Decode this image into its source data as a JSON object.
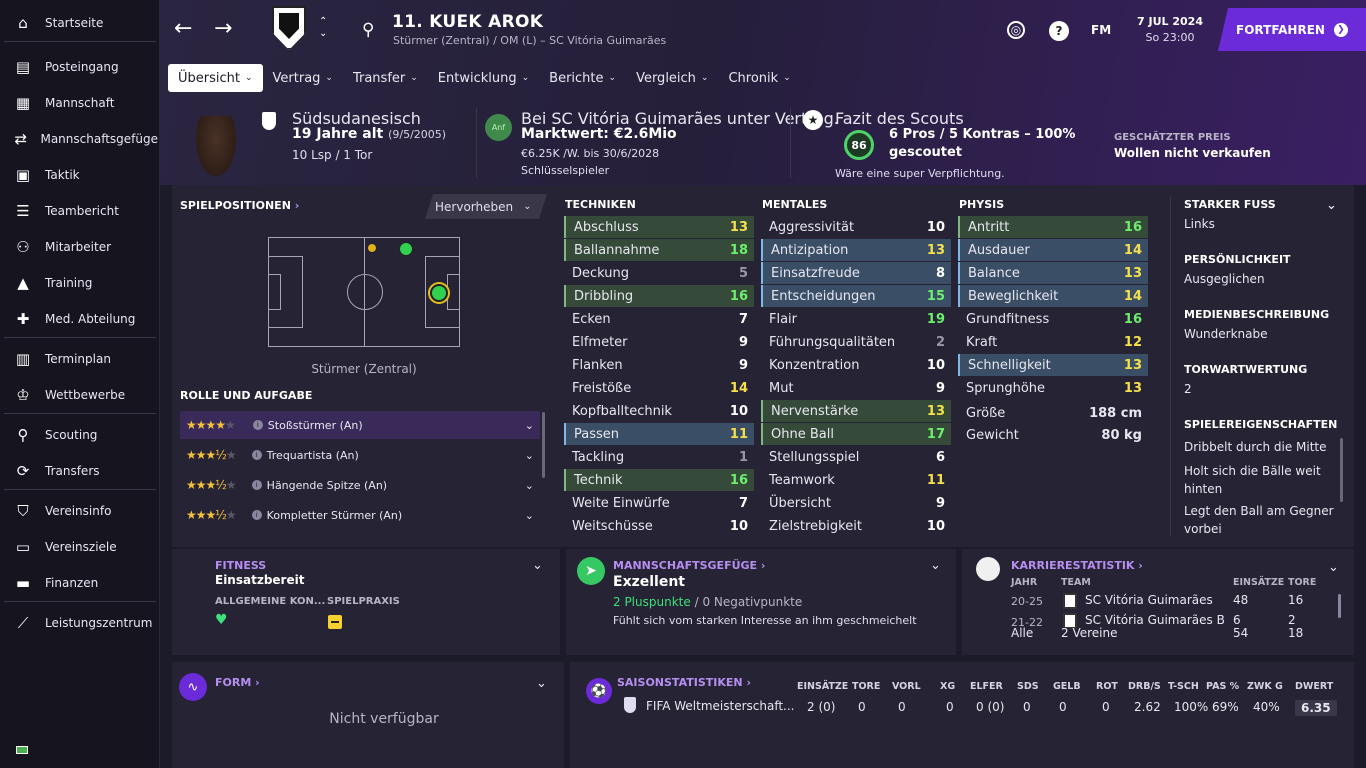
{
  "sidebar": {
    "items": [
      {
        "label": "Startseite",
        "icon": "home-icon"
      },
      {
        "label": "Posteingang",
        "icon": "inbox-icon"
      },
      {
        "label": "Mannschaft",
        "icon": "shirt-icon"
      },
      {
        "label": "Mannschaftsgefüge",
        "icon": "dynamics-icon"
      },
      {
        "label": "Taktik",
        "icon": "tactics-icon"
      },
      {
        "label": "Teambericht",
        "icon": "report-icon"
      },
      {
        "label": "Mitarbeiter",
        "icon": "staff-icon"
      },
      {
        "label": "Training",
        "icon": "training-icon"
      },
      {
        "label": "Med. Abteilung",
        "icon": "medical-icon"
      },
      {
        "label": "Terminplan",
        "icon": "calendar-icon"
      },
      {
        "label": "Wettbewerbe",
        "icon": "trophy-icon"
      },
      {
        "label": "Scouting",
        "icon": "search-icon"
      },
      {
        "label": "Transfers",
        "icon": "transfer-icon"
      },
      {
        "label": "Vereinsinfo",
        "icon": "shield-icon"
      },
      {
        "label": "Vereinsziele",
        "icon": "briefcase-icon"
      },
      {
        "label": "Finanzen",
        "icon": "money-icon"
      },
      {
        "label": "Leistungszentrum",
        "icon": "chart-icon"
      }
    ]
  },
  "header": {
    "player_name": "11. KUEK AROK",
    "player_sub": "Stürmer (Zentral) / OM (L) – SC Vitória Guimarães",
    "fm_label": "FM",
    "date": "7 JUL 2024",
    "time": "So 23:00",
    "continue_label": "FORTFAHREN"
  },
  "tabs": [
    {
      "label": "Übersicht",
      "active": true
    },
    {
      "label": "Vertrag"
    },
    {
      "label": "Transfer"
    },
    {
      "label": "Entwicklung"
    },
    {
      "label": "Berichte"
    },
    {
      "label": "Vergleich"
    },
    {
      "label": "Chronik"
    }
  ],
  "info": {
    "nationality": "Südsudanesisch",
    "age": "19 Jahre alt",
    "dob": "(9/5/2005)",
    "caps": "10 Lsp / 1 Tor",
    "contract_label": "Bei SC Vitória Guimarães unter Vertrag.",
    "value": "Marktwert: €2.6Mio",
    "wage": "€6.25K /W. bis 30/6/2028",
    "status": "Schlüsselspieler",
    "badge": "Anf",
    "scout_label": "Fazit des Scouts",
    "scout_score": "86",
    "scout_line1": "6 Pros / 5 Kontras – 100%",
    "scout_line2": "gescoutet",
    "scout_note": "Wäre eine super Verpflichtung.",
    "price_label": "GESCHÄTZTER PREIS",
    "price_value": "Wollen nicht verkaufen"
  },
  "positions": {
    "title": "SPIELPOSITIONEN",
    "highlight_btn": "Hervorheben",
    "position_label": "Stürmer (Zentral)",
    "role_title": "ROLLE UND AUFGABE",
    "roles": [
      {
        "name": "Stoßstürmer (An)",
        "stars": 4,
        "half": false
      },
      {
        "name": "Trequartista (An)",
        "stars": 3,
        "half": true
      },
      {
        "name": "Hängende Spitze (An)",
        "stars": 3,
        "half": true
      },
      {
        "name": "Kompletter Stürmer (An)",
        "stars": 3,
        "half": true
      }
    ]
  },
  "attributes": {
    "techniken_title": "TECHNIKEN",
    "mentales_title": "MENTALES",
    "physis_title": "PHYSIS",
    "techniken": [
      [
        "Abschluss",
        "13"
      ],
      [
        "Ballannahme",
        "18"
      ],
      [
        "Deckung",
        "5"
      ],
      [
        "Dribbling",
        "16"
      ],
      [
        "Ecken",
        "7"
      ],
      [
        "Elfmeter",
        "9"
      ],
      [
        "Flanken",
        "9"
      ],
      [
        "Freistöße",
        "14"
      ],
      [
        "Kopfballtechnik",
        "10"
      ],
      [
        "Passen",
        "11"
      ],
      [
        "Tackling",
        "1"
      ],
      [
        "Technik",
        "16"
      ],
      [
        "Weite Einwürfe",
        "7"
      ],
      [
        "Weitschüsse",
        "10"
      ]
    ],
    "mentales": [
      [
        "Aggressivität",
        "10"
      ],
      [
        "Antizipation",
        "13"
      ],
      [
        "Einsatzfreude",
        "8"
      ],
      [
        "Entscheidungen",
        "15"
      ],
      [
        "Flair",
        "19"
      ],
      [
        "Führungsqualitäten",
        "2"
      ],
      [
        "Konzentration",
        "10"
      ],
      [
        "Mut",
        "9"
      ],
      [
        "Nervenstärke",
        "13"
      ],
      [
        "Ohne Ball",
        "17"
      ],
      [
        "Stellungsspiel",
        "6"
      ],
      [
        "Teamwork",
        "11"
      ],
      [
        "Übersicht",
        "9"
      ],
      [
        "Zielstrebigkeit",
        "10"
      ]
    ],
    "physis": [
      [
        "Antritt",
        "16"
      ],
      [
        "Ausdauer",
        "14"
      ],
      [
        "Balance",
        "13"
      ],
      [
        "Beweglichkeit",
        "14"
      ],
      [
        "Grundfitness",
        "16"
      ],
      [
        "Kraft",
        "12"
      ],
      [
        "Schnelligkeit",
        "13"
      ],
      [
        "Sprunghöhe",
        "13"
      ]
    ],
    "groesse_label": "Größe",
    "groesse": "188 cm",
    "gewicht_label": "Gewicht",
    "gewicht": "80 kg"
  },
  "sideinfo": {
    "foot_label": "STARKER FUSS",
    "foot": "Links",
    "pers_label": "PERSÖNLICHKEIT",
    "pers": "Ausgeglichen",
    "media_label": "MEDIENBESCHREIBUNG",
    "media": "Wunderknabe",
    "gk_label": "TORWARTWERTUNG",
    "gk": "2",
    "traits_label": "SPIELEREIGENSCHAFTEN",
    "traits": [
      "Dribbelt durch die Mitte",
      "Holt sich die Bälle weit hinten",
      "Legt den Ball am Gegner vorbei"
    ]
  },
  "fitness": {
    "title": "FITNESS",
    "status": "Einsatzbereit",
    "cond_label": "ALLGEMEINE KON...",
    "prax_label": "SPIELPRAXIS"
  },
  "morale": {
    "title": "MANNSCHAFTSGEFÜGE",
    "status": "Exzellent",
    "plus": "2 Pluspunkte",
    "sep": "/",
    "minus": "0 Negativpunkte",
    "note": "Fühlt sich vom starken Interesse an ihm geschmeichelt"
  },
  "career": {
    "title": "KARRIERESTATISTIK",
    "h_year": "JAHR",
    "h_team": "TEAM",
    "h_apps": "EINSÄTZE",
    "h_goals": "TORE",
    "rows": [
      {
        "year": "20-25",
        "team": "SC Vitória Guimarães",
        "apps": "48",
        "goals": "16"
      },
      {
        "year": "21-22",
        "team": "SC Vitória Guimarães B",
        "apps": "6",
        "goals": "2"
      },
      {
        "year": "Alle",
        "team": "2 Vereine",
        "apps": "54",
        "goals": "18"
      }
    ]
  },
  "form": {
    "title": "FORM",
    "note": "Nicht verfügbar"
  },
  "season": {
    "title": "SAISONSTATISTIKEN",
    "headers": [
      "EINSÄTZE",
      "TORE",
      "VORL",
      "XG",
      "ELFER",
      "SDS",
      "GELB",
      "ROT",
      "DRB/S",
      "T-SCH",
      "PAS %",
      "ZWK G",
      "DWERT"
    ],
    "row": {
      "comp": "FIFA Weltmeisterschaft...",
      "vals": [
        "2 (0)",
        "0",
        "0",
        "0",
        "0 (0)",
        "0",
        "0",
        "0",
        "2.62",
        "100%",
        "69%",
        "40%",
        "6.35"
      ]
    }
  }
}
